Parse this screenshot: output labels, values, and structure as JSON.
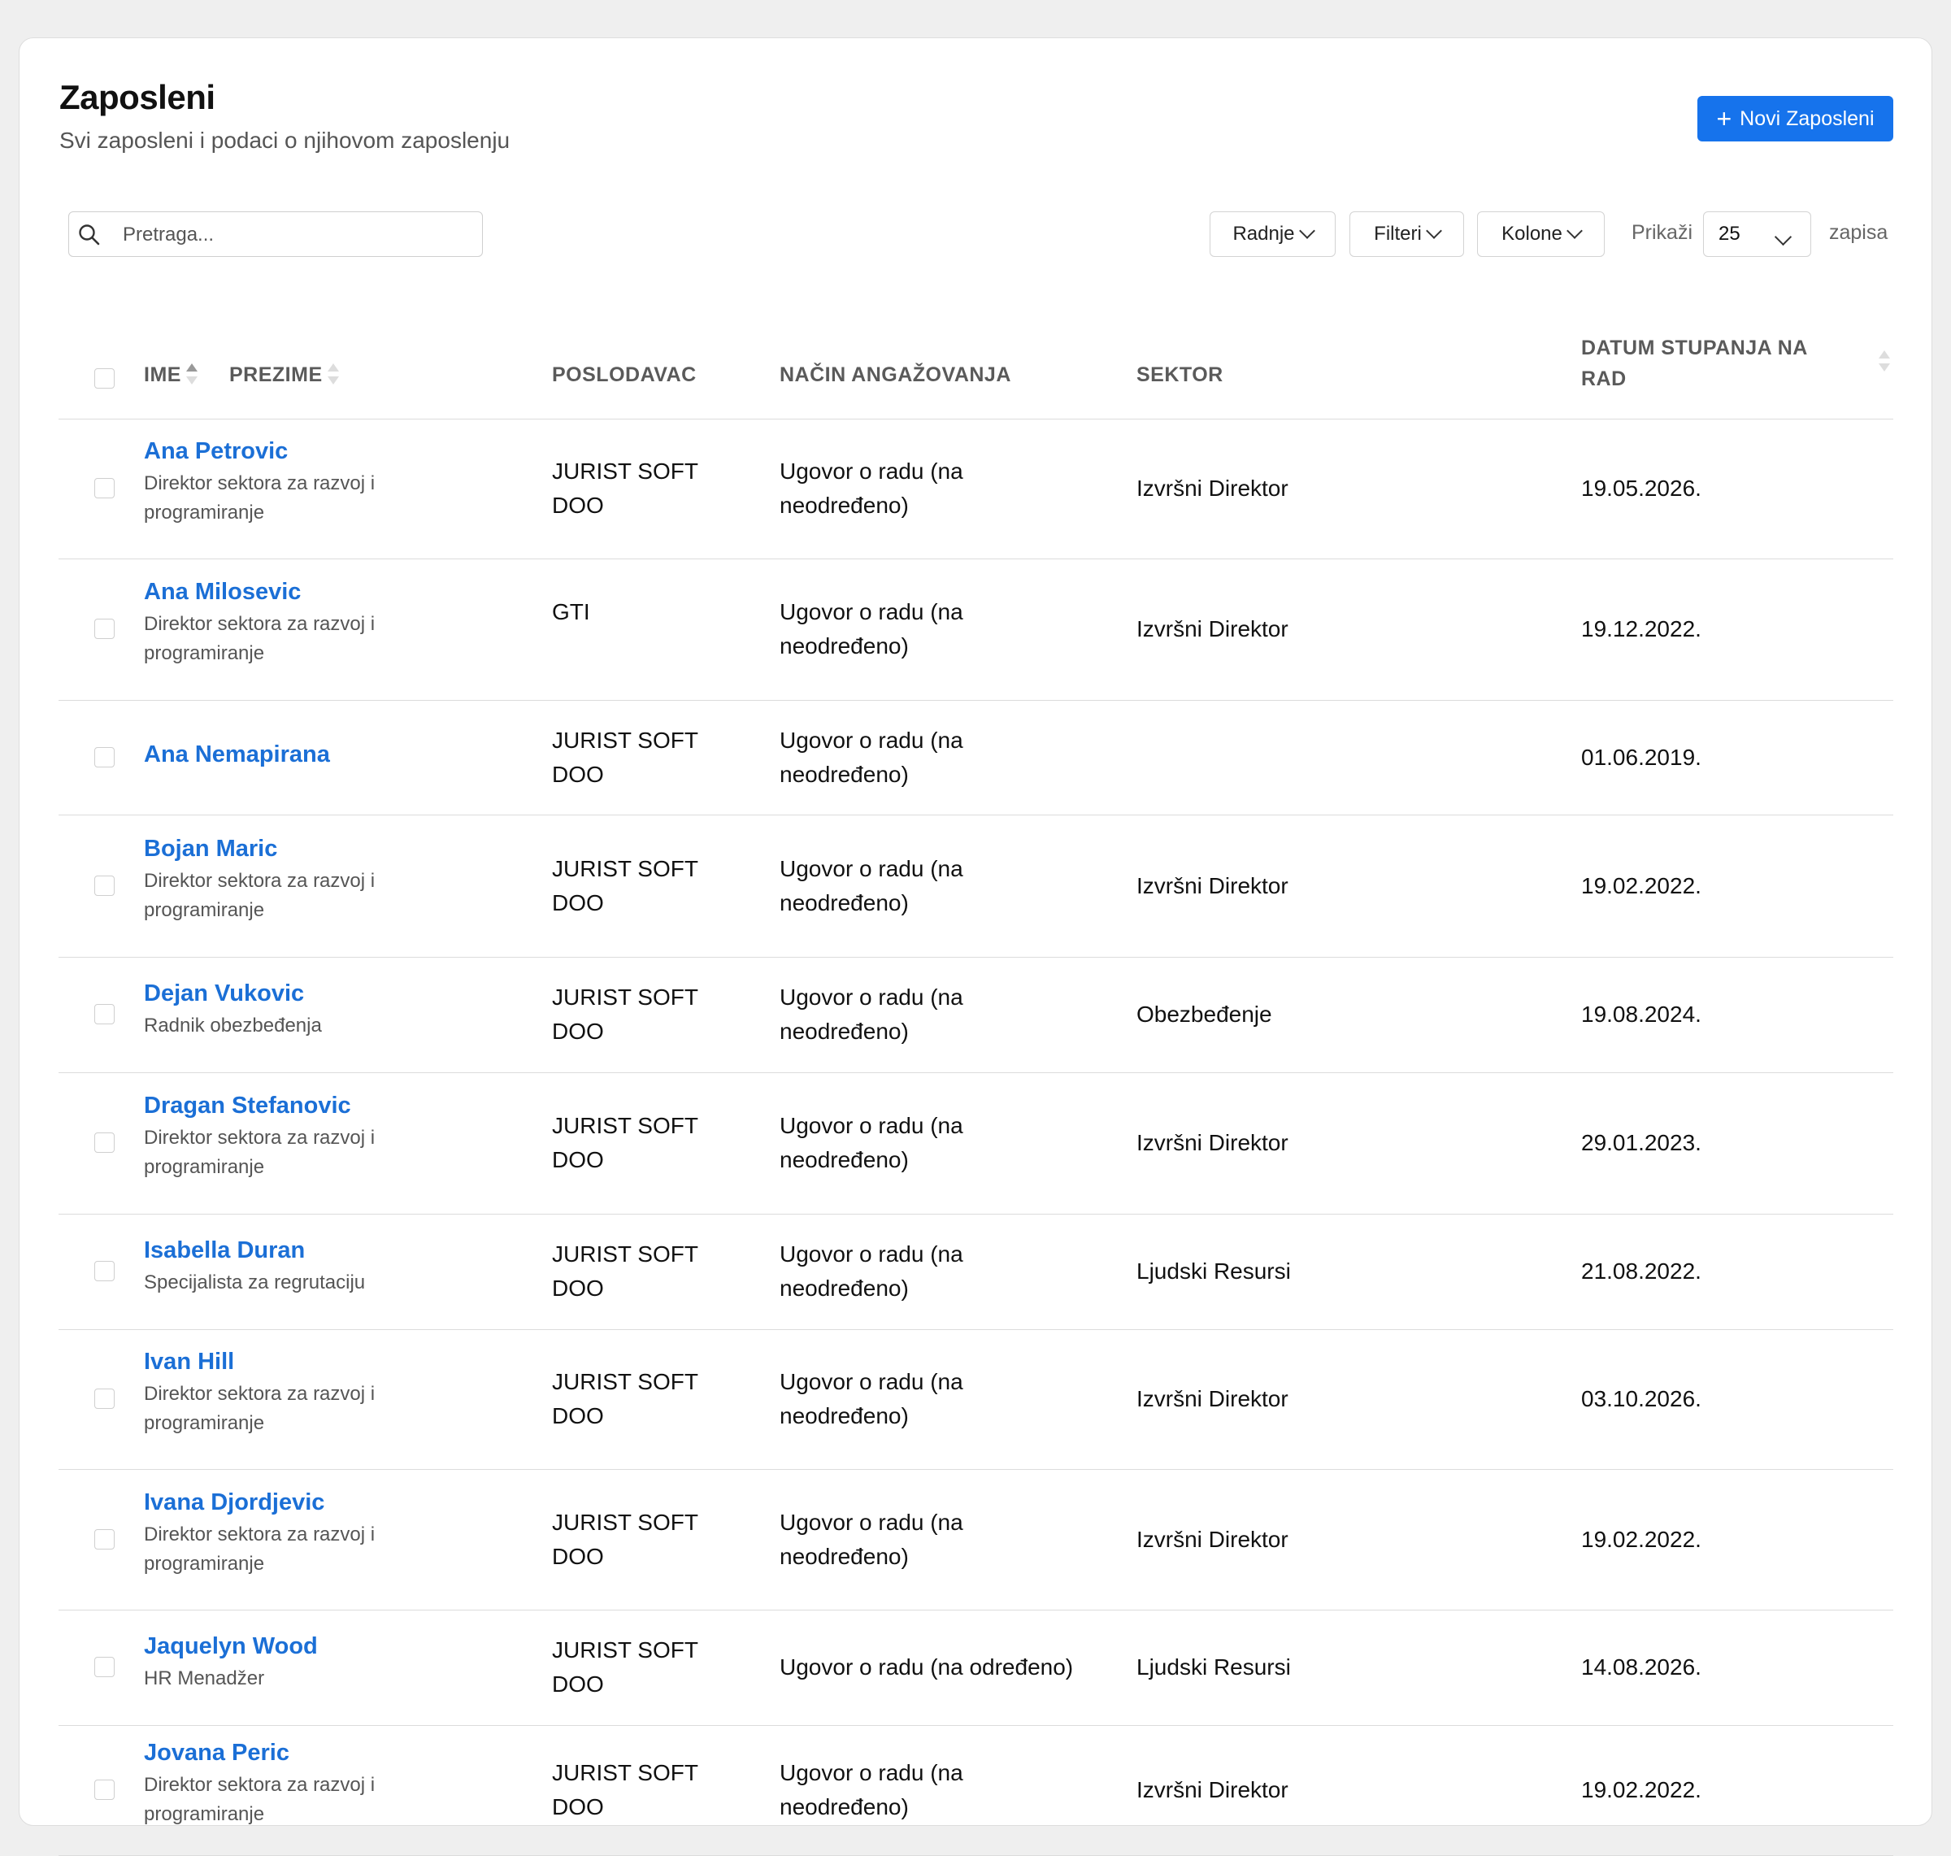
{
  "header": {
    "title": "Zaposleni",
    "subtitle": "Svi zaposleni i podaci o njihovom zaposlenju",
    "new_button_label": "Novi Zaposleni"
  },
  "toolbar": {
    "search_placeholder": "Pretraga...",
    "actions_label": "Radnje",
    "filters_label": "Filteri",
    "columns_label": "Kolone",
    "show_label": "Prikaži",
    "page_size": "25",
    "records_label": "zapisa"
  },
  "table": {
    "columns": {
      "first_name": "IME",
      "last_name": "PREZIME",
      "employer": "POSLODAVAC",
      "engagement": "NAČIN ANGAŽOVANJA",
      "sector": "SEKTOR",
      "start_date": "DATUM STUPANJA NA RAD"
    },
    "rows": [
      {
        "name": "Ana Petrovic",
        "role": "Direktor sektora za razvoj i programiranje",
        "employer": "JURIST SOFT DOO",
        "engagement": "Ugovor o radu (na neodređeno)",
        "sector": "Izvršni Direktor",
        "date": "19.05.2026."
      },
      {
        "name": "Ana Milosevic",
        "role": "Direktor sektora za razvoj i programiranje",
        "employer": "GTI",
        "engagement": "Ugovor o radu (na neodređeno)",
        "sector": "Izvršni Direktor",
        "date": "19.12.2022."
      },
      {
        "name": "Ana Nemapirana",
        "role": "",
        "employer": "JURIST SOFT DOO",
        "engagement": "Ugovor o radu (na neodređeno)",
        "sector": "",
        "date": "01.06.2019."
      },
      {
        "name": "Bojan Maric",
        "role": "Direktor sektora za razvoj i programiranje",
        "employer": "JURIST SOFT DOO",
        "engagement": "Ugovor o radu (na neodređeno)",
        "sector": "Izvršni Direktor",
        "date": "19.02.2022."
      },
      {
        "name": "Dejan Vukovic",
        "role": "Radnik obezbeđenja",
        "employer": "JURIST SOFT DOO",
        "engagement": "Ugovor o radu (na neodređeno)",
        "sector": "Obezbeđenje",
        "date": "19.08.2024."
      },
      {
        "name": "Dragan Stefanovic",
        "role": "Direktor sektora za razvoj i programiranje",
        "employer": "JURIST SOFT DOO",
        "engagement": "Ugovor o radu (na neodređeno)",
        "sector": "Izvršni Direktor",
        "date": "29.01.2023."
      },
      {
        "name": "Isabella Duran",
        "role": "Specijalista za regrutaciju",
        "employer": "JURIST SOFT DOO",
        "engagement": "Ugovor o radu (na neodređeno)",
        "sector": "Ljudski Resursi",
        "date": "21.08.2022."
      },
      {
        "name": "Ivan Hill",
        "role": "Direktor sektora za razvoj i programiranje",
        "employer": "JURIST SOFT DOO",
        "engagement": "Ugovor o radu (na neodređeno)",
        "sector": "Izvršni Direktor",
        "date": "03.10.2026."
      },
      {
        "name": "Ivana Djordjevic",
        "role": "Direktor sektora za razvoj i programiranje",
        "employer": "JURIST SOFT DOO",
        "engagement": "Ugovor o radu (na neodređeno)",
        "sector": "Izvršni Direktor",
        "date": "19.02.2022."
      },
      {
        "name": "Jaquelyn Wood",
        "role": "HR Menadžer",
        "employer": "JURIST SOFT DOO",
        "engagement": "Ugovor o radu (na određeno)",
        "sector": "Ljudski Resursi",
        "date": "14.08.2026."
      },
      {
        "name": "Jovana Peric",
        "role": "Direktor sektora za razvoj i programiranje",
        "employer": "JURIST SOFT DOO",
        "engagement": "Ugovor o radu (na neodređeno)",
        "sector": "Izvršni Direktor",
        "date": "19.02.2022."
      }
    ]
  }
}
